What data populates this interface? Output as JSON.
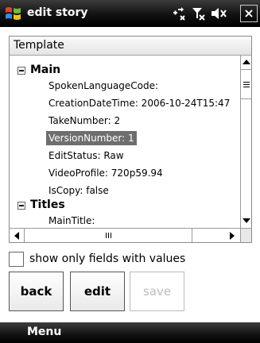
{
  "window": {
    "title": "edit story",
    "close_label": "×"
  },
  "status_icons": [
    "connectivity-icon",
    "signal-off-icon",
    "volume-off-icon"
  ],
  "template_header": "Template",
  "tree": {
    "groups": [
      {
        "label": "Main",
        "expander": "minus",
        "fields": [
          "SpokenLanguageCode:",
          "CreationDateTime: 2006-10-24T15:47",
          "TakeNumber: 2",
          "VersionNumber: 1",
          "EditStatus: Raw",
          "VideoProfile: 720p59.94",
          "IsCopy: false"
        ]
      },
      {
        "label": "Titles",
        "expander": "minus",
        "fields": [
          "MainTitle:"
        ]
      }
    ],
    "selected_field": "VersionNumber: 1"
  },
  "checkbox": {
    "label": "show only fields with values",
    "checked": false
  },
  "buttons": {
    "back": "back",
    "edit": "edit",
    "save": "save"
  },
  "softkeys": {
    "left": "Menu"
  },
  "colors": {
    "titlebar": "#000000",
    "selection": "#6e6e6e",
    "disabled_text": "#bcbcbc"
  }
}
